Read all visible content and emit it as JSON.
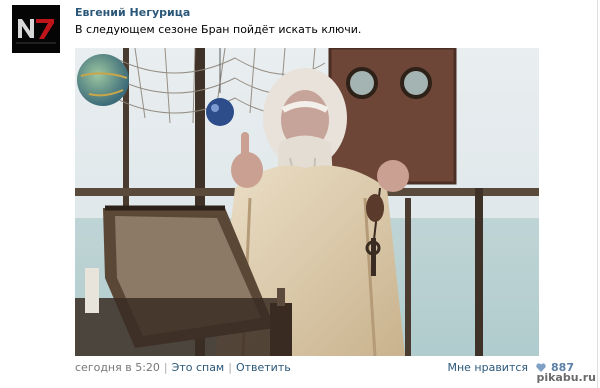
{
  "post": {
    "author": "Евгений Негурица",
    "avatar_logo": "N7",
    "text": "В следующем сезоне Бран пойдёт искать ключи.",
    "meta": {
      "time": "сегодня в 5:20",
      "spam_link": "Это спам",
      "reply_link": "Ответить"
    },
    "like": {
      "label": "Мне нравится",
      "count": "887",
      "icon": "heart-icon"
    }
  },
  "watermark": "pikabu.ru",
  "colors": {
    "link": "#2b587a",
    "meta": "#777777",
    "avatar_bg": "#050505",
    "avatar_red": "#c0141b"
  }
}
